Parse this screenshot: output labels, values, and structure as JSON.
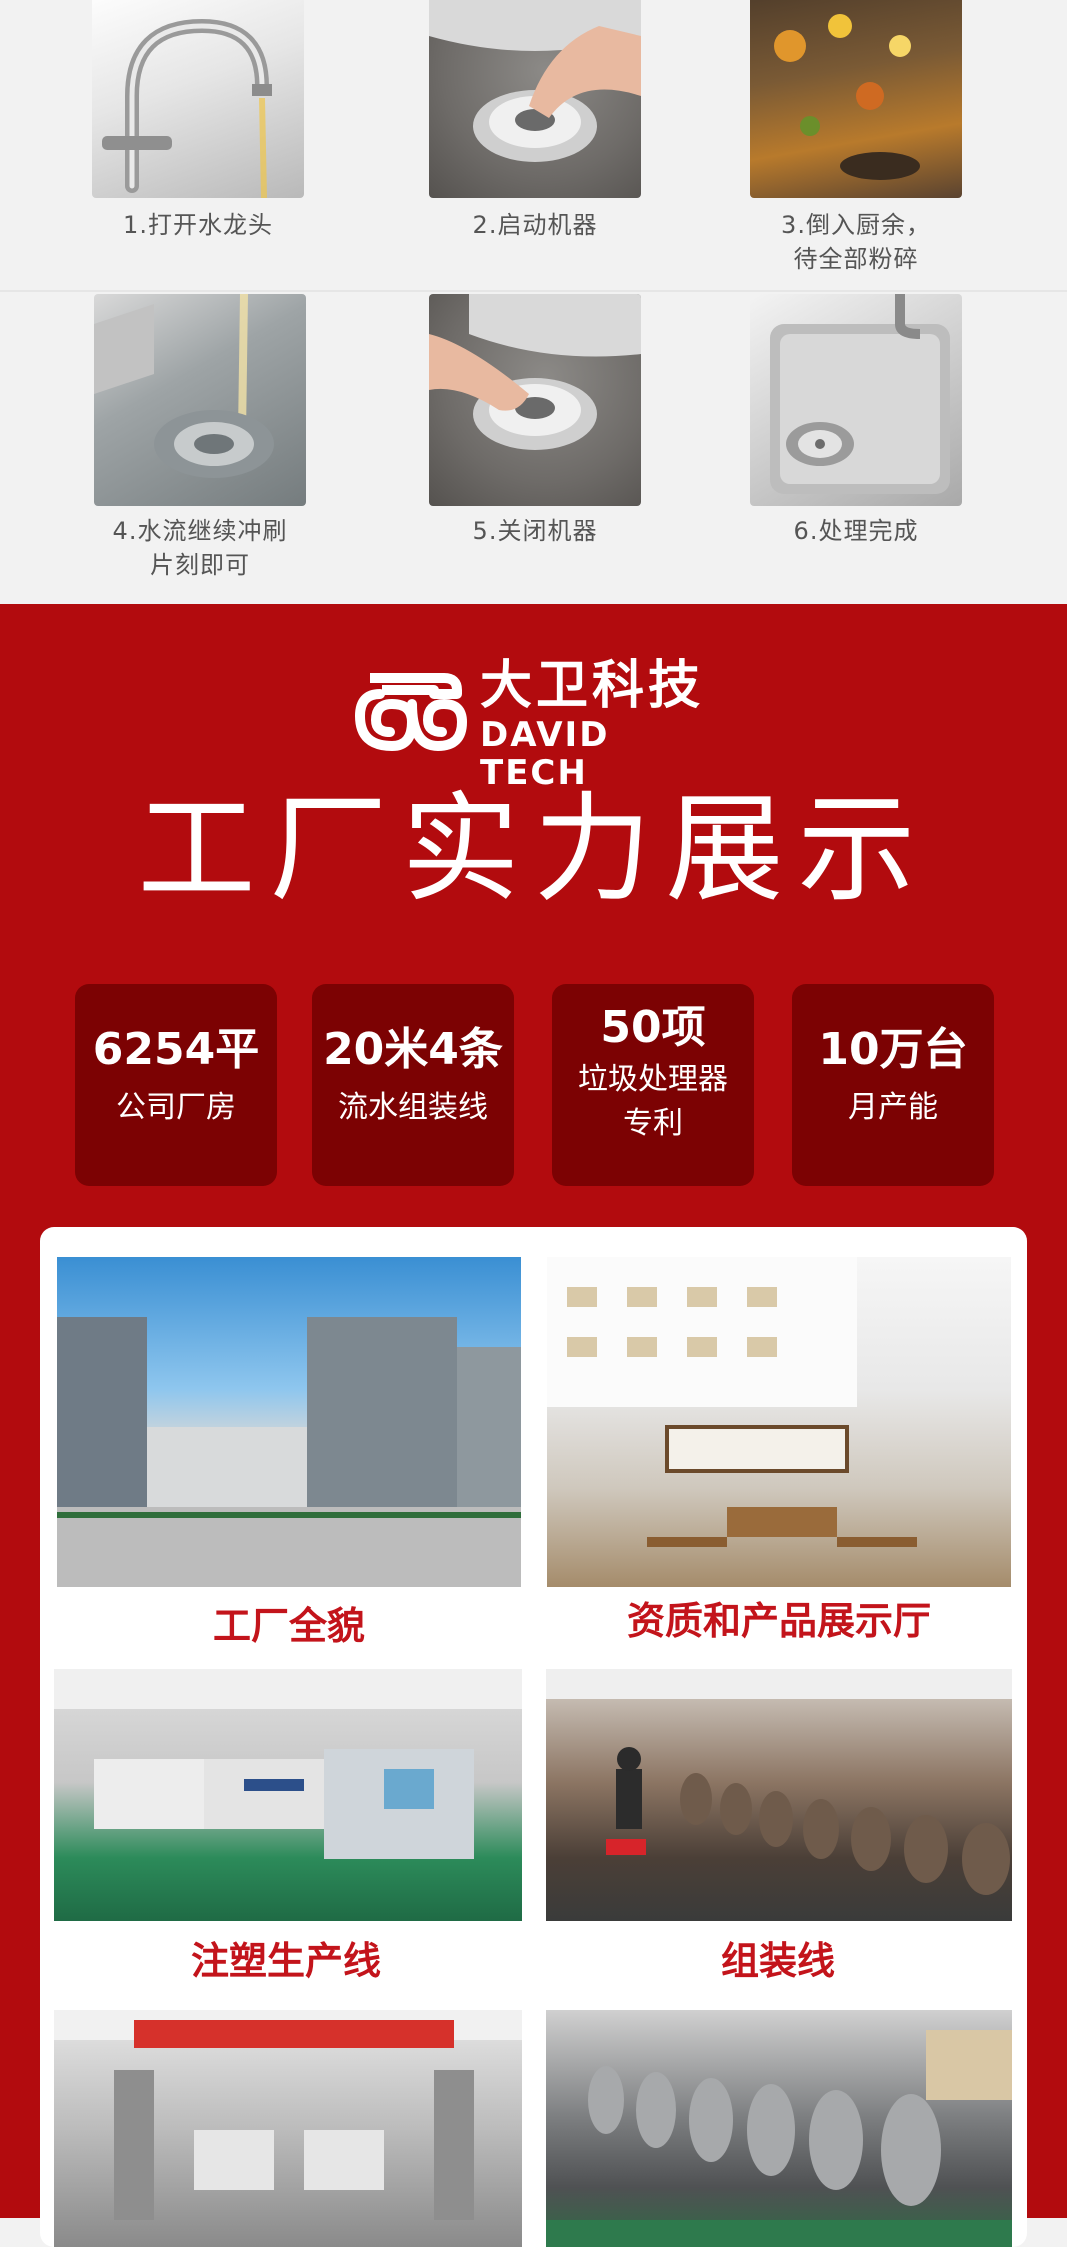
{
  "steps": [
    {
      "caption_lines": [
        "1.打开水龙头"
      ],
      "icon": "faucet-photo"
    },
    {
      "caption_lines": [
        "2.启动机器"
      ],
      "icon": "push-button-photo"
    },
    {
      "caption_lines": [
        "3.倒入厨余，",
        "待全部粉碎"
      ],
      "icon": "food-waste-photo"
    },
    {
      "caption_lines": [
        "4.水流继续冲刷",
        "片刻即可"
      ],
      "icon": "sink-water-photo"
    },
    {
      "caption_lines": [
        "5.关闭机器"
      ],
      "icon": "push-button-photo"
    },
    {
      "caption_lines": [
        "6.处理完成"
      ],
      "icon": "clean-sink-photo"
    }
  ],
  "brand": {
    "name_cn": "大卫科技",
    "name_en": "DAVID TECH"
  },
  "headline": "工厂实力展示",
  "stats": [
    {
      "value": "6254平",
      "desc_lines": [
        "公司厂房"
      ]
    },
    {
      "value": "20米4条",
      "desc_lines": [
        "流水组装线"
      ]
    },
    {
      "value": "50项",
      "desc_lines": [
        "垃圾处理器",
        "专利"
      ]
    },
    {
      "value": "10万台",
      "desc_lines": [
        "月产能"
      ]
    }
  ],
  "factory_photos": [
    {
      "label": "工厂全貌",
      "icon": "factory-building-photo"
    },
    {
      "label": "资质和产品展示厅",
      "icon": "showroom-photo"
    },
    {
      "label": "注塑生产线",
      "icon": "injection-molding-photo"
    },
    {
      "label": "组装线",
      "icon": "assembly-line-photo"
    },
    {
      "label": "",
      "icon": "workshop-photo"
    },
    {
      "label": "",
      "icon": "product-row-photo"
    }
  ],
  "colors": {
    "red_bg": "#b20b0e",
    "stat_bg": "#7c0203",
    "label_red": "#c3141b",
    "top_bg": "#f2f2f2"
  }
}
